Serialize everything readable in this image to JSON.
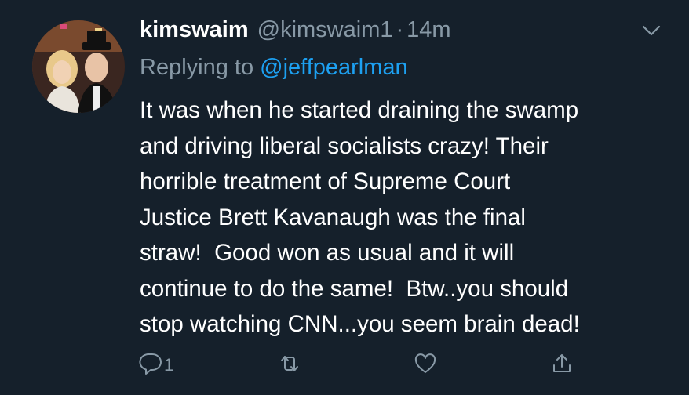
{
  "colors": {
    "background": "#15202b",
    "primary_text": "#ffffff",
    "secondary_text": "#8899a6",
    "link": "#1da1f2"
  },
  "tweet": {
    "display_name": "kimswaim",
    "handle": "@kimswaim1",
    "separator": "·",
    "time": "14m",
    "replying_prefix": "Replying to",
    "replying_to": "@jeffpearlman",
    "body_lines": [
      "It was when he started draining the swamp",
      "and driving liberal socialists crazy! Their",
      "horrible treatment of Supreme Court",
      "Justice Brett Kavanaugh was the final",
      "straw!  Good won as usual and it will",
      "continue to do the same!  Btw..you should",
      "stop watching CNN...you seem brain dead!"
    ]
  },
  "actions": {
    "reply": {
      "icon": "reply-icon",
      "count": "1"
    },
    "retweet": {
      "icon": "retweet-icon"
    },
    "like": {
      "icon": "heart-icon"
    },
    "share": {
      "icon": "share-icon"
    },
    "menu": {
      "icon": "chevron-down-icon"
    }
  }
}
